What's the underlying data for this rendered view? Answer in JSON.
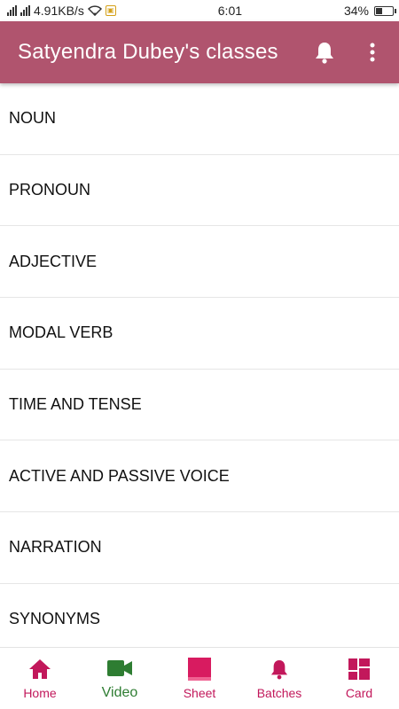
{
  "status_bar": {
    "network_speed": "4.91KB/s",
    "time": "6:01",
    "battery": "34%",
    "battery_level": 0.34
  },
  "app_bar": {
    "title": "Satyendra Dubey's classes",
    "actions": [
      {
        "icon": "bell-icon"
      },
      {
        "icon": "more-vertical-icon"
      }
    ]
  },
  "topics": [
    "NOUN",
    "PRONOUN",
    "ADJECTIVE",
    "MODAL VERB",
    "TIME AND TENSE",
    "ACTIVE AND PASSIVE VOICE",
    "NARRATION",
    "SYNONYMS"
  ],
  "bottom_nav": {
    "items": [
      {
        "label": "Home",
        "icon": "home-icon",
        "color": "#c2185b"
      },
      {
        "label": "Video",
        "icon": "video-camera-icon",
        "color": "#2e7d32"
      },
      {
        "label": "Sheet",
        "icon": "sheet-icon",
        "color": "#c2185b"
      },
      {
        "label": "Batches",
        "icon": "bell-icon",
        "color": "#c2185b"
      },
      {
        "label": "Card",
        "icon": "dashboard-icon",
        "color": "#c2185b"
      }
    ]
  },
  "colors": {
    "app_bar": "#b0546e",
    "accent": "#c2185b",
    "video": "#2e7d32"
  }
}
